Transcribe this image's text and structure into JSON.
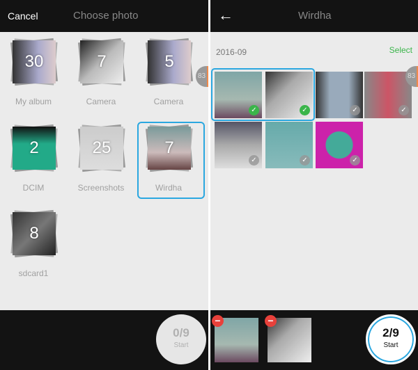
{
  "left": {
    "cancel": "Cancel",
    "title": "Choose photo",
    "scroll_badge": "83",
    "albums": [
      {
        "count": "30",
        "name": "My album"
      },
      {
        "count": "7",
        "name": "Camera"
      },
      {
        "count": "5",
        "name": "Camera"
      },
      {
        "count": "2",
        "name": "DCIM"
      },
      {
        "count": "25",
        "name": "Screenshots"
      },
      {
        "count": "7",
        "name": "Wirdha"
      },
      {
        "count": "8",
        "name": "sdcard1"
      }
    ],
    "selected_album": "Wirdha",
    "counter": "0/9",
    "start": "Start"
  },
  "right": {
    "back_icon": "arrow-left-icon",
    "title": "Wirdha",
    "date": "2016-09",
    "select": "Select",
    "scroll_badge": "83",
    "photos_selected": [
      true,
      true,
      false,
      false,
      false,
      false,
      false
    ],
    "counter": "2/9",
    "start": "Start",
    "tray_count": 2
  },
  "colors": {
    "accent": "#2aa7e0",
    "check": "#3ab54a",
    "select": "#3ab54a",
    "remove": "#e8413b"
  }
}
